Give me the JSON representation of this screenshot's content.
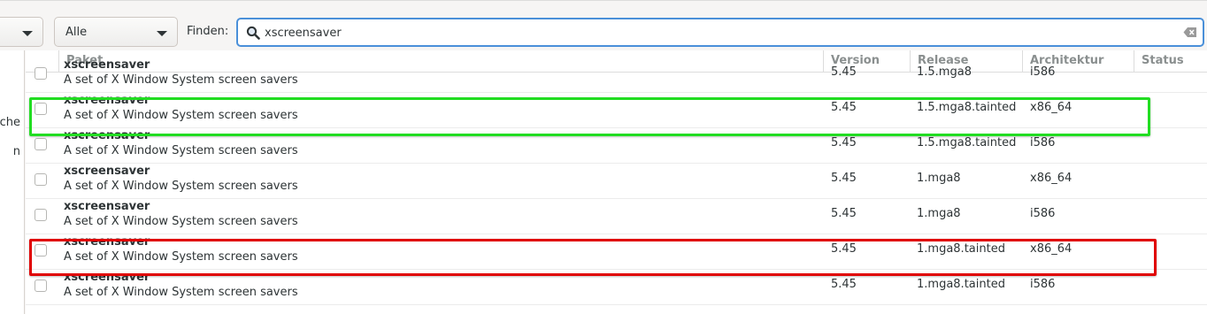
{
  "filters": {
    "combo1_value": "",
    "combo2_value": "Alle",
    "find_label": "Finden:",
    "search_value": "xscreensaver"
  },
  "sidebar": {
    "items": [
      "che",
      "n"
    ]
  },
  "table": {
    "columns": [
      "Paket",
      "Version",
      "Release",
      "Architektur",
      "Status"
    ],
    "rows": [
      {
        "name": "xscreensaver",
        "description": "A set of X Window System screen savers",
        "version": "5.45",
        "release": "1.5.mga8",
        "arch": "i586",
        "status": ""
      },
      {
        "name": "xscreensaver",
        "description": "A set of X Window System screen savers",
        "version": "5.45",
        "release": "1.5.mga8.tainted",
        "arch": "x86_64",
        "status": ""
      },
      {
        "name": "xscreensaver",
        "description": "A set of X Window System screen savers",
        "version": "5.45",
        "release": "1.5.mga8.tainted",
        "arch": "i586",
        "status": ""
      },
      {
        "name": "xscreensaver",
        "description": "A set of X Window System screen savers",
        "version": "5.45",
        "release": "1.mga8",
        "arch": "x86_64",
        "status": ""
      },
      {
        "name": "xscreensaver",
        "description": "A set of X Window System screen savers",
        "version": "5.45",
        "release": "1.mga8",
        "arch": "i586",
        "status": ""
      },
      {
        "name": "xscreensaver",
        "description": "A set of X Window System screen savers",
        "version": "5.45",
        "release": "1.mga8.tainted",
        "arch": "x86_64",
        "status": ""
      },
      {
        "name": "xscreensaver",
        "description": "A set of X Window System screen savers",
        "version": "5.45",
        "release": "1.mga8.tainted",
        "arch": "i586",
        "status": ""
      }
    ]
  },
  "highlights": [
    {
      "row": 1,
      "color": "#22dd22"
    },
    {
      "row": 5,
      "color": "#e00000"
    }
  ],
  "icons": {
    "search": "search-icon",
    "clear": "clear-text-icon",
    "dropdown": "chevron-down-icon"
  }
}
